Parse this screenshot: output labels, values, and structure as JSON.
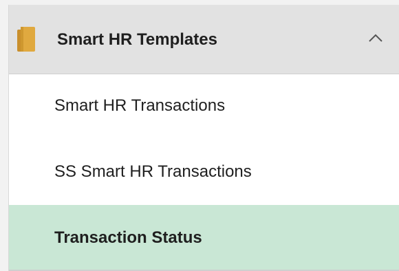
{
  "menu": {
    "header": {
      "title": "Smart HR Templates",
      "icon": "folder-icon",
      "toggle_icon": "chevron-up-icon",
      "expanded": true
    },
    "items": [
      {
        "label": "Smart HR Transactions",
        "selected": false
      },
      {
        "label": "SS Smart HR Transactions",
        "selected": false
      },
      {
        "label": "Transaction Status",
        "selected": true
      }
    ]
  },
  "colors": {
    "header_background": "#e2e2e2",
    "selected_background": "#c9e7d5",
    "folder_icon": "#e0a93f",
    "text": "#1f1f1f"
  }
}
